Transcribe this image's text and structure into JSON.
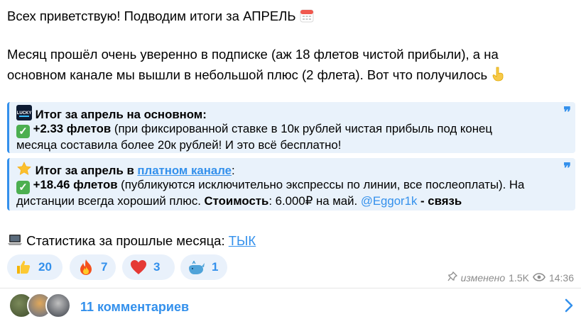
{
  "message": {
    "greeting": "Всех приветствую! Подводим итоги за АПРЕЛЬ",
    "para_line1": "Месяц прошёл очень уверенно в подписке (аж 18 флетов чистой прибыли), а на",
    "para_line2": "основном канале мы вышли в небольшой плюс (2 флета). Вот что получилось",
    "quote1": {
      "title": "Итог за апрель на основном:",
      "value": "+2.33 флетов",
      "text1": " (при фиксированной ставке в 10к рублей чистая прибыль под конец",
      "text2": "месяца составила более 20к рублей! И это всё бесплатно!"
    },
    "quote2": {
      "title_prefix": "Итог за апрель в ",
      "title_link": "платном канале",
      "title_suffix": ":",
      "value": "+18.46 флетов",
      "text1": " (публикуются исключительно экспрессы по линии, все послеоплаты). На",
      "text2_a": "дистанции всегда хороший плюс. ",
      "cost_label": "Стоимость",
      "cost_value": ": 6.000₽ на май. ",
      "mention": "@Eggor1k",
      "contact": " - связь"
    },
    "stats_label": "Статистика за прошлые месяца: ",
    "stats_link": "ТЫК"
  },
  "reactions": [
    {
      "icon": "thumbs-up",
      "count": "20"
    },
    {
      "icon": "fire",
      "count": "7"
    },
    {
      "icon": "heart",
      "count": "3"
    },
    {
      "icon": "whale",
      "count": "1"
    }
  ],
  "meta": {
    "edited": "изменено",
    "views": "1.5K",
    "time": "14:36"
  },
  "comments": {
    "label": "11 комментариев"
  },
  "colors": {
    "accent": "#3390ec",
    "quote_bg": "#e9f2fb",
    "reaction_bg": "#e9f1fb"
  }
}
